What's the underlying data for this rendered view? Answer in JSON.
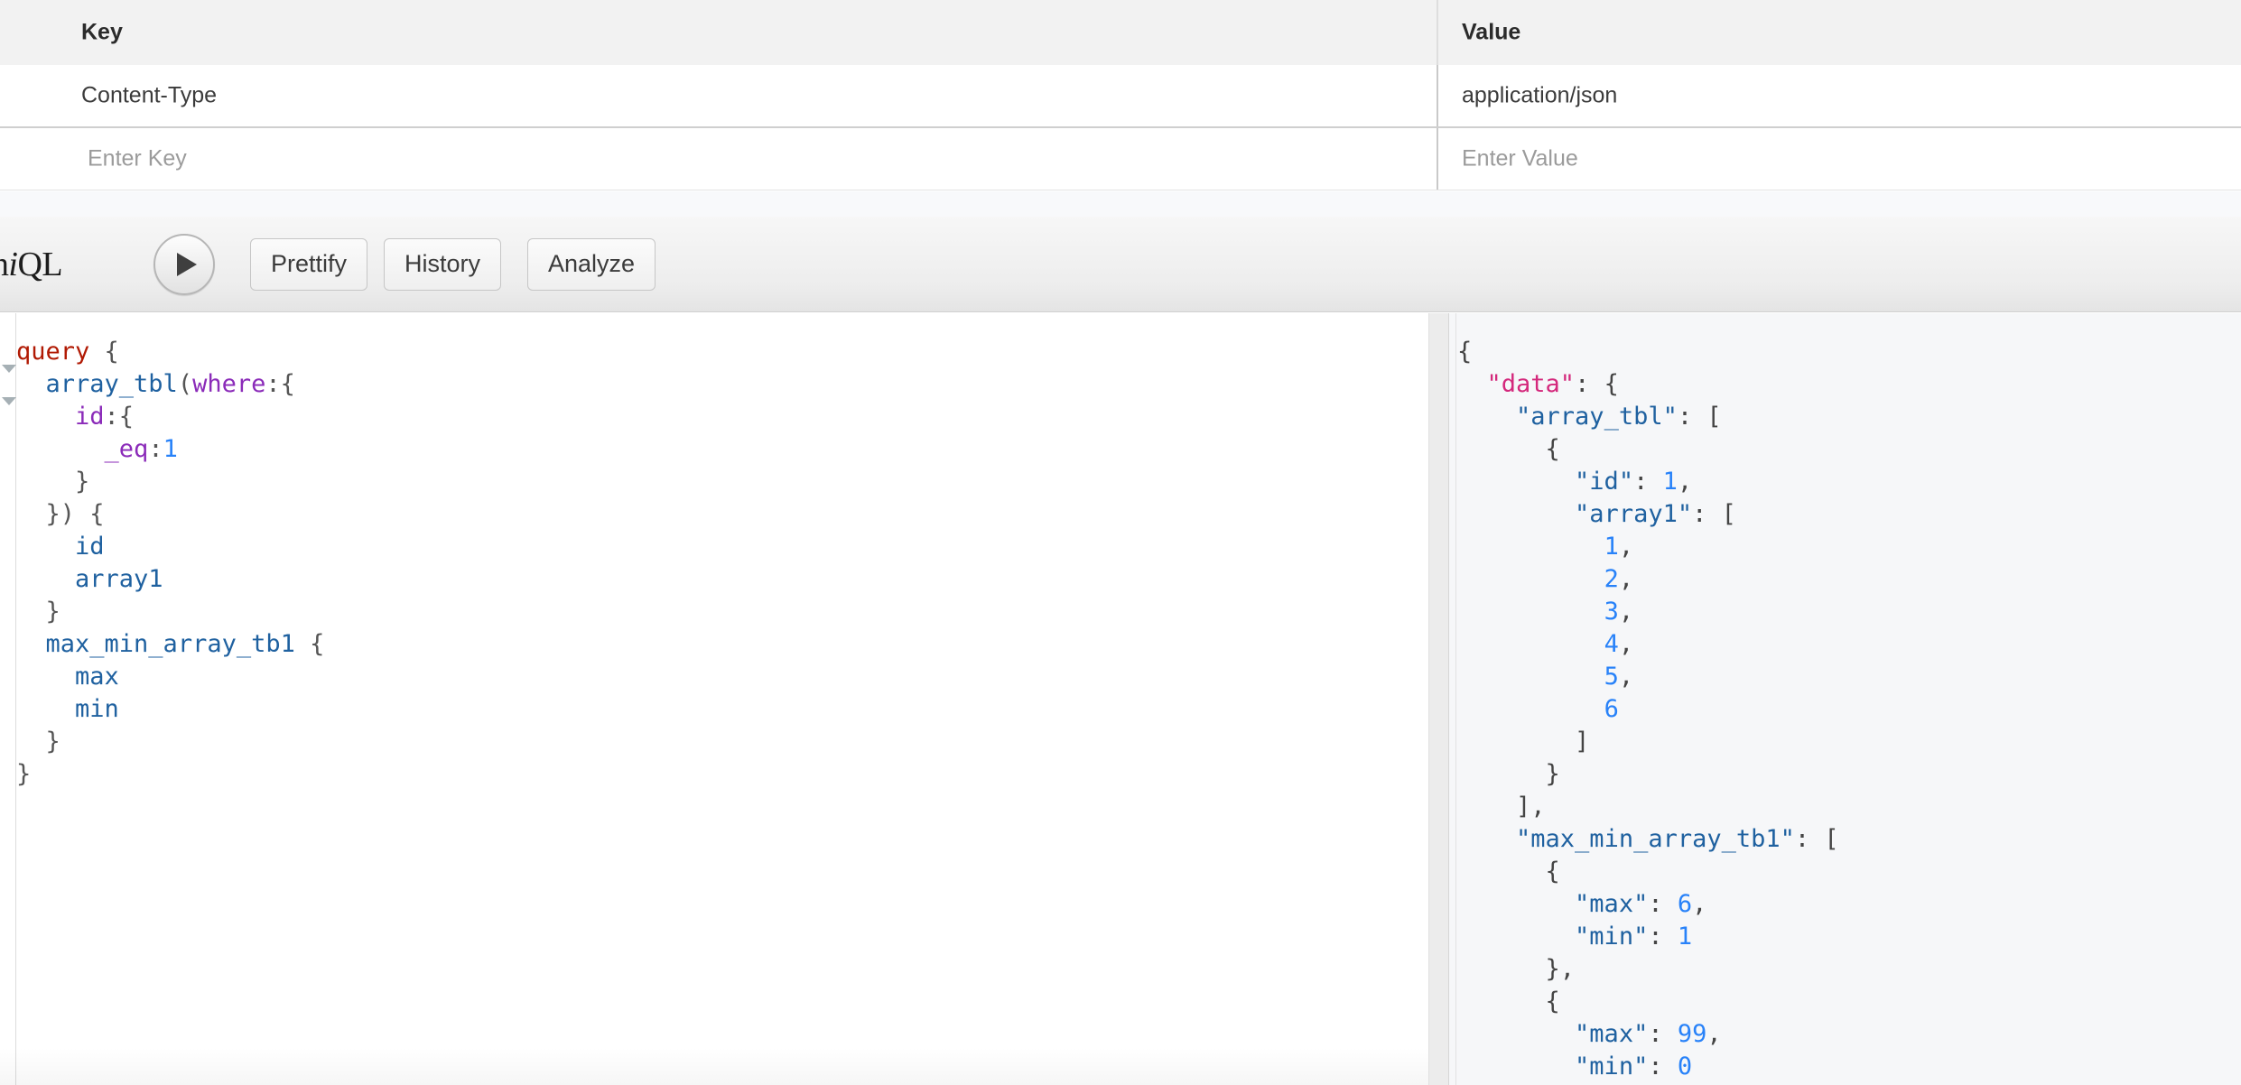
{
  "headers_table": {
    "columns": [
      "Key",
      "Value"
    ],
    "rows": [
      {
        "key": "Content-Type",
        "value": "application/json"
      }
    ],
    "new_row": {
      "key_placeholder": "Enter Key",
      "value_placeholder": "Enter Value"
    }
  },
  "toolbar": {
    "logo_prefix": "aph",
    "logo_italic": "i",
    "logo_suffix": "QL",
    "execute_label": "",
    "buttons": [
      "Prettify",
      "History",
      "Analyze"
    ]
  },
  "query_editor": {
    "lines": [
      [
        {
          "t": "kw",
          "s": "query"
        },
        {
          "t": "punc",
          "s": " {"
        }
      ],
      [
        {
          "t": "punc",
          "s": "  "
        },
        {
          "t": "def",
          "s": "array_tbl"
        },
        {
          "t": "punc",
          "s": "("
        },
        {
          "t": "arg",
          "s": "where"
        },
        {
          "t": "punc",
          "s": ":{"
        }
      ],
      [
        {
          "t": "punc",
          "s": "    "
        },
        {
          "t": "arg",
          "s": "id"
        },
        {
          "t": "punc",
          "s": ":{"
        }
      ],
      [
        {
          "t": "punc",
          "s": "      "
        },
        {
          "t": "arg",
          "s": "_eq"
        },
        {
          "t": "punc",
          "s": ":"
        },
        {
          "t": "num",
          "s": "1"
        }
      ],
      [
        {
          "t": "punc",
          "s": "    }"
        }
      ],
      [
        {
          "t": "punc",
          "s": "  }) {"
        }
      ],
      [
        {
          "t": "punc",
          "s": "    "
        },
        {
          "t": "attr",
          "s": "id"
        }
      ],
      [
        {
          "t": "punc",
          "s": "    "
        },
        {
          "t": "attr",
          "s": "array1"
        }
      ],
      [
        {
          "t": "punc",
          "s": "  }"
        }
      ],
      [
        {
          "t": "punc",
          "s": "  "
        },
        {
          "t": "def",
          "s": "max_min_array_tb1"
        },
        {
          "t": "punc",
          "s": " {"
        }
      ],
      [
        {
          "t": "punc",
          "s": "    "
        },
        {
          "t": "attr",
          "s": "max"
        }
      ],
      [
        {
          "t": "punc",
          "s": "    "
        },
        {
          "t": "attr",
          "s": "min"
        }
      ],
      [
        {
          "t": "punc",
          "s": "  }"
        }
      ],
      [
        {
          "t": "punc",
          "s": "}"
        }
      ]
    ],
    "plain_text": "query {\n  array_tbl(where:{\n    id:{\n      _eq:1\n    }\n  }) {\n    id\n    array1\n  }\n  max_min_array_tb1 {\n    max\n    min\n  }\n}"
  },
  "result_panel": {
    "lines": [
      [
        {
          "t": "jpunc",
          "s": "{"
        }
      ],
      [
        {
          "t": "jpunc",
          "s": "  "
        },
        {
          "t": "jdata",
          "s": "\"data\""
        },
        {
          "t": "jpunc",
          "s": ": {"
        }
      ],
      [
        {
          "t": "jpunc",
          "s": "    "
        },
        {
          "t": "jkey",
          "s": "\"array_tbl\""
        },
        {
          "t": "jpunc",
          "s": ": ["
        }
      ],
      [
        {
          "t": "jpunc",
          "s": "      {"
        }
      ],
      [
        {
          "t": "jpunc",
          "s": "        "
        },
        {
          "t": "jkey",
          "s": "\"id\""
        },
        {
          "t": "jpunc",
          "s": ": "
        },
        {
          "t": "jnum",
          "s": "1"
        },
        {
          "t": "jpunc",
          "s": ","
        }
      ],
      [
        {
          "t": "jpunc",
          "s": "        "
        },
        {
          "t": "jkey",
          "s": "\"array1\""
        },
        {
          "t": "jpunc",
          "s": ": ["
        }
      ],
      [
        {
          "t": "jpunc",
          "s": "          "
        },
        {
          "t": "jnum",
          "s": "1"
        },
        {
          "t": "jpunc",
          "s": ","
        }
      ],
      [
        {
          "t": "jpunc",
          "s": "          "
        },
        {
          "t": "jnum",
          "s": "2"
        },
        {
          "t": "jpunc",
          "s": ","
        }
      ],
      [
        {
          "t": "jpunc",
          "s": "          "
        },
        {
          "t": "jnum",
          "s": "3"
        },
        {
          "t": "jpunc",
          "s": ","
        }
      ],
      [
        {
          "t": "jpunc",
          "s": "          "
        },
        {
          "t": "jnum",
          "s": "4"
        },
        {
          "t": "jpunc",
          "s": ","
        }
      ],
      [
        {
          "t": "jpunc",
          "s": "          "
        },
        {
          "t": "jnum",
          "s": "5"
        },
        {
          "t": "jpunc",
          "s": ","
        }
      ],
      [
        {
          "t": "jpunc",
          "s": "          "
        },
        {
          "t": "jnum",
          "s": "6"
        }
      ],
      [
        {
          "t": "jpunc",
          "s": "        ]"
        }
      ],
      [
        {
          "t": "jpunc",
          "s": "      }"
        }
      ],
      [
        {
          "t": "jpunc",
          "s": "    ],"
        }
      ],
      [
        {
          "t": "jpunc",
          "s": "    "
        },
        {
          "t": "jkey",
          "s": "\"max_min_array_tb1\""
        },
        {
          "t": "jpunc",
          "s": ": ["
        }
      ],
      [
        {
          "t": "jpunc",
          "s": "      {"
        }
      ],
      [
        {
          "t": "jpunc",
          "s": "        "
        },
        {
          "t": "jkey",
          "s": "\"max\""
        },
        {
          "t": "jpunc",
          "s": ": "
        },
        {
          "t": "jnum",
          "s": "6"
        },
        {
          "t": "jpunc",
          "s": ","
        }
      ],
      [
        {
          "t": "jpunc",
          "s": "        "
        },
        {
          "t": "jkey",
          "s": "\"min\""
        },
        {
          "t": "jpunc",
          "s": ": "
        },
        {
          "t": "jnum",
          "s": "1"
        }
      ],
      [
        {
          "t": "jpunc",
          "s": "      },"
        }
      ],
      [
        {
          "t": "jpunc",
          "s": "      {"
        }
      ],
      [
        {
          "t": "jpunc",
          "s": "        "
        },
        {
          "t": "jkey",
          "s": "\"max\""
        },
        {
          "t": "jpunc",
          "s": ": "
        },
        {
          "t": "jnum",
          "s": "99"
        },
        {
          "t": "jpunc",
          "s": ","
        }
      ],
      [
        {
          "t": "jpunc",
          "s": "        "
        },
        {
          "t": "jkey",
          "s": "\"min\""
        },
        {
          "t": "jpunc",
          "s": ": "
        },
        {
          "t": "jnum",
          "s": "0"
        }
      ]
    ],
    "plain_text": "{\n  \"data\": {\n    \"array_tbl\": [\n      {\n        \"id\": 1,\n        \"array1\": [\n          1,\n          2,\n          3,\n          4,\n          5,\n          6\n        ]\n      }\n    ],\n    \"max_min_array_tb1\": [\n      {\n        \"max\": 6,\n        \"min\": 1\n      },\n      {\n        \"max\": 99,\n        \"min\": 0"
  },
  "colors": {
    "keyword": "#b11a04",
    "definition": "#1f61a0",
    "argument": "#8b2bb9",
    "number": "#2882f9",
    "json_data_key": "#d4287c",
    "toolbar_bg": "#ededed",
    "result_bg": "#f6f7f9"
  }
}
